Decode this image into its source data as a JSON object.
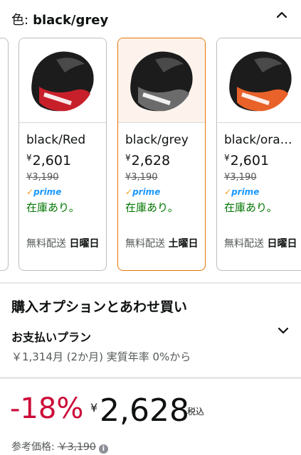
{
  "color_selector": {
    "label": "色:",
    "selected": "black/grey"
  },
  "swatches": [
    {
      "name": "black/Red",
      "price": "2,601",
      "list_price": "¥3,190",
      "prime": "prime",
      "stock": "在庫あり。",
      "delivery_prefix": "無料配送",
      "delivery_day": "日曜日",
      "accent_color": "#c8202a"
    },
    {
      "name": "black/grey",
      "price": "2,628",
      "list_price": "¥3,190",
      "prime": "prime",
      "stock": "在庫あり。",
      "delivery_prefix": "無料配送",
      "delivery_day": "土曜日",
      "accent_color": "#6b6b6b"
    },
    {
      "name": "black/ora…",
      "price": "2,601",
      "list_price": "¥3,190",
      "prime": "prime",
      "stock": "在庫あり。",
      "delivery_prefix": "無料配送",
      "delivery_day": "日曜日",
      "accent_color": "#e8622a"
    }
  ],
  "purchase_options": {
    "title": "購入オプションとあわせ買い",
    "plan_title": "お支払いプラン",
    "plan_detail": "￥1,314月 (2か月) 実質年率 0%から"
  },
  "price_block": {
    "discount": "-18%",
    "currency": "¥",
    "price": "2,628",
    "tax_label": "税込",
    "ref_label": "参考価格:",
    "ref_price": "￥3,190"
  },
  "colors": {
    "selected_border": "#e77600",
    "discount_red": "#cc0c39",
    "stock_green": "#007600",
    "prime_blue": "#1a98ff"
  }
}
